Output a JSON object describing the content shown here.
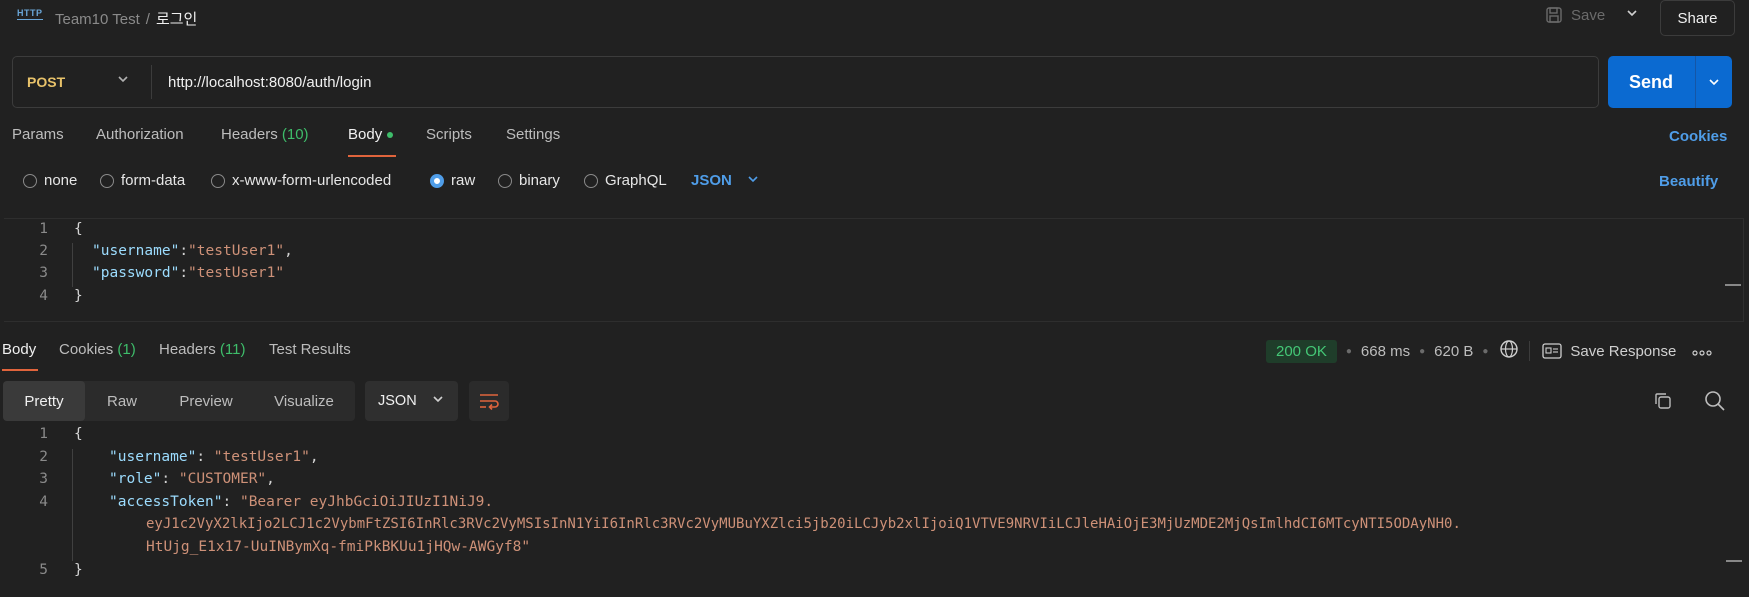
{
  "topbar": {
    "app_icon": "http-icon",
    "app_icon_text": "HTTP",
    "collection": "Team10 Test",
    "separator": "/",
    "request_name": "로그인",
    "save_label": "Save",
    "share_label": "Share"
  },
  "request": {
    "method": "POST",
    "url": "http://localhost:8080/auth/login",
    "send_label": "Send"
  },
  "request_tabs": [
    {
      "label": "Params"
    },
    {
      "label": "Authorization"
    },
    {
      "label": "Headers",
      "count": "(10)"
    },
    {
      "label": "Body",
      "active": true
    },
    {
      "label": "Scripts"
    },
    {
      "label": "Settings"
    }
  ],
  "cookies_link": "Cookies",
  "body_modes": {
    "options": [
      "none",
      "form-data",
      "x-www-form-urlencoded",
      "raw",
      "binary",
      "GraphQL"
    ],
    "selected": "raw",
    "format": "JSON",
    "beautify_label": "Beautify"
  },
  "request_body": {
    "line_numbers": [
      "1",
      "2",
      "3",
      "4"
    ],
    "open_brace": "{",
    "close_brace": "}",
    "username_key": "\"username\"",
    "username_value": "\"testUser1\"",
    "password_key": "\"password\"",
    "password_value": "\"testUser1\"",
    "colon": ":",
    "comma": ","
  },
  "response_tabs": [
    {
      "label": "Body",
      "active": true
    },
    {
      "label": "Cookies",
      "count": "(1)"
    },
    {
      "label": "Headers",
      "count": "(11)"
    },
    {
      "label": "Test Results"
    }
  ],
  "response_meta": {
    "status": "200 OK",
    "time": "668 ms",
    "size": "620 B",
    "save_response_label": "Save Response",
    "more_label": "ooo"
  },
  "response_view": {
    "modes": [
      "Pretty",
      "Raw",
      "Preview",
      "Visualize"
    ],
    "active_mode": "Pretty",
    "format": "JSON"
  },
  "response_body": {
    "line_numbers": [
      "1",
      "2",
      "3",
      "4",
      "",
      "",
      "5"
    ],
    "open_brace": "{",
    "close_brace": "}",
    "username_key": "\"username\"",
    "username_value": "\"testUser1\"",
    "role_key": "\"role\"",
    "role_value": "\"CUSTOMER\"",
    "token_key": "\"accessToken\"",
    "token_line1": "\"Bearer eyJhbGciOiJIUzI1NiJ9.",
    "token_line2": "eyJ1c2VyX2lkIjo2LCJ1c2VybmFtZSI6InRlc3RVc2VyMSIsInN1YiI6InRlc3RVc2VyMUBuYXZlci5jb20iLCJyb2xlIjoiQ1VTVE9NRVIiLCJleHAiOjE3MjUzMDE2MjQsImlhdCI6MTcyNTI5ODAyNH0.",
    "token_line3": "HtUjg_E1x17-UuINBymXq-fmiPkBKUu1jHQw-AWGyf8\"",
    "colon_space": ": ",
    "comma": ","
  },
  "colors": {
    "background": "#212121",
    "accent_blue": "#4f9de8",
    "send_blue": "#0b6ad1",
    "tab_underline": "#e0643c",
    "count_green": "#3ebd6a",
    "json_key": "#9cdcfe",
    "json_string": "#ce9178",
    "method_post": "#e8c26a"
  }
}
